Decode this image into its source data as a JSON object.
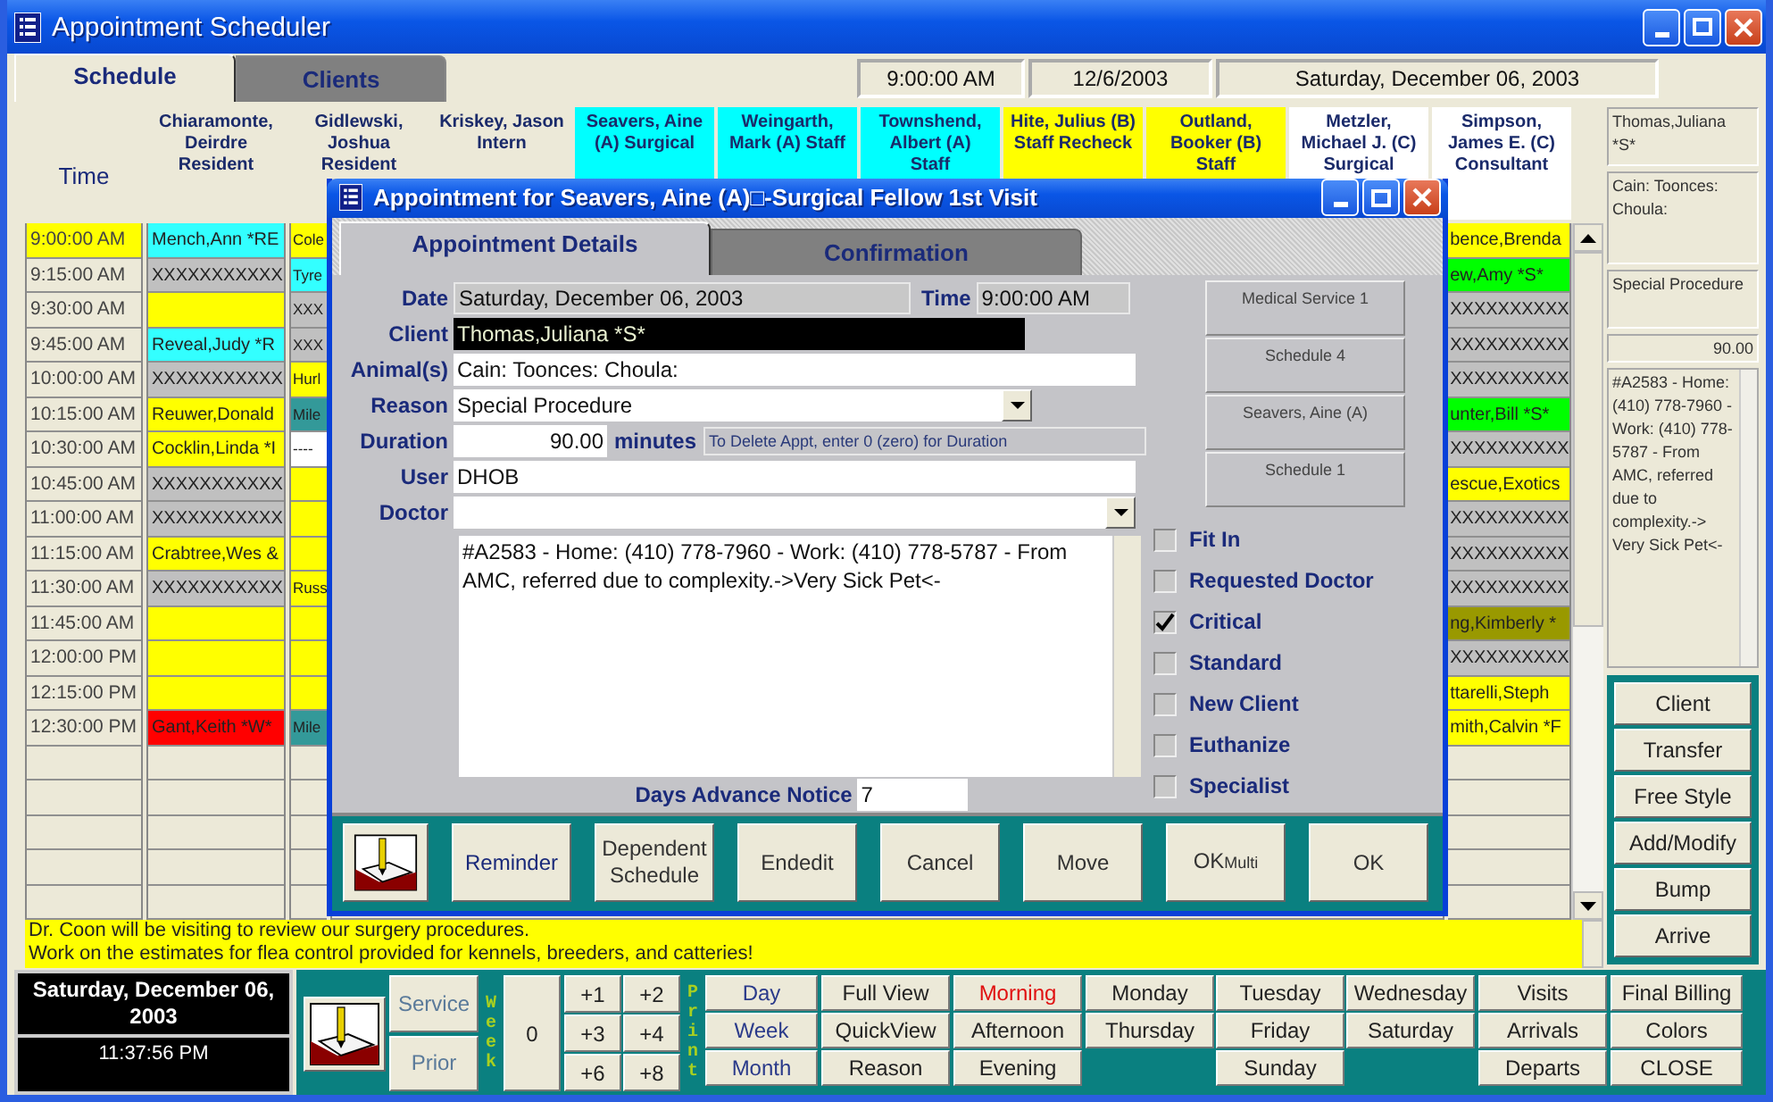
{
  "window": {
    "title": "Appointment Scheduler"
  },
  "tabs": [
    {
      "label": "Schedule",
      "selected": true
    },
    {
      "label": "Clients",
      "selected": false
    }
  ],
  "current_time": "9:00:00 AM",
  "current_date": "12/6/2003",
  "long_date": "Saturday, December 06, 2003",
  "schedule": {
    "time_heading": "Time",
    "columns": [
      {
        "name": "Chiaramonte, Deirdre Resident",
        "color": "#ece9d8"
      },
      {
        "name": "Gidlewski, Joshua Resident",
        "color": "#ece9d8"
      },
      {
        "name": "Kriskey, Jason Intern",
        "color": "#ece9d8"
      },
      {
        "name": "Seavers, Aine (A) Surgical",
        "color": "#00ffff"
      },
      {
        "name": "Weingarth, Mark (A) Staff",
        "color": "#00ffff"
      },
      {
        "name": "Townshend, Albert (A) Staff",
        "color": "#00ffff"
      },
      {
        "name": "Hite, Julius (B) Staff Recheck",
        "color": "#ffff00"
      },
      {
        "name": "Outland, Booker (B) Staff",
        "color": "#ffff00"
      },
      {
        "name": "Metzler, Michael J. (C) Surgical",
        "color": "#ffffff"
      },
      {
        "name": "Simpson, James E. (C) Consultant",
        "color": "#ffffff"
      }
    ],
    "rows": [
      {
        "time": "9:00:00 AM",
        "selected": true,
        "cells": [
          {
            "text": "Mench,Ann *RE",
            "color": "#33ffff"
          },
          {
            "text": "Cole",
            "color": "#ffff00"
          },
          {
            "text": "bence,Brenda",
            "color": "#ffff00"
          }
        ]
      },
      {
        "time": "9:15:00 AM",
        "selected": false,
        "cells": [
          {
            "text": "XXXXXXXXXXX",
            "color": "#c0c0c0"
          },
          {
            "text": "Tyre",
            "color": "#33ffff"
          },
          {
            "text": "ew,Amy *S*",
            "color": "#00ff00"
          }
        ]
      },
      {
        "time": "9:30:00 AM",
        "selected": false,
        "cells": [
          {
            "color": "#ffff00"
          },
          {
            "text": "XXX",
            "color": "#c0c0c0"
          },
          {
            "text": "XXXXXXXXXX",
            "color": "#c0c0c0"
          }
        ]
      },
      {
        "time": "9:45:00 AM",
        "selected": false,
        "cells": [
          {
            "text": "Reveal,Judy *R",
            "color": "#33ffff"
          },
          {
            "text": "XXX",
            "color": "#c0c0c0"
          },
          {
            "text": "XXXXXXXXXX",
            "color": "#c0c0c0"
          }
        ]
      },
      {
        "time": "10:00:00 AM",
        "selected": false,
        "cells": [
          {
            "text": "XXXXXXXXXXX",
            "color": "#c0c0c0"
          },
          {
            "text": "Hurl",
            "color": "#ffff00"
          },
          {
            "text": "XXXXXXXXXX",
            "color": "#c0c0c0"
          }
        ]
      },
      {
        "time": "10:15:00 AM",
        "selected": false,
        "cells": [
          {
            "text": "Reuwer,Donald",
            "color": "#ffff00"
          },
          {
            "text": "Mile",
            "color": "#339999"
          },
          {
            "text": "unter,Bill *S*",
            "color": "#00ff00"
          }
        ]
      },
      {
        "time": "10:30:00 AM",
        "selected": false,
        "cells": [
          {
            "text": "Cocklin,Linda *I",
            "color": "#ffff00"
          },
          {
            "text": "----",
            "color": "#ffffff"
          },
          {
            "text": "XXXXXXXXXX",
            "color": "#c0c0c0"
          }
        ]
      },
      {
        "time": "10:45:00 AM",
        "selected": false,
        "cells": [
          {
            "text": "XXXXXXXXXXX",
            "color": "#c0c0c0"
          },
          {
            "color": "#ffff00"
          },
          {
            "text": "escue,Exotics",
            "color": "#ffff00"
          }
        ]
      },
      {
        "time": "11:00:00 AM",
        "selected": false,
        "cells": [
          {
            "text": "XXXXXXXXXXX",
            "color": "#c0c0c0"
          },
          {
            "color": "#ffff00"
          },
          {
            "text": "XXXXXXXXXX",
            "color": "#c0c0c0"
          }
        ]
      },
      {
        "time": "11:15:00 AM",
        "selected": false,
        "cells": [
          {
            "text": "Crabtree,Wes &",
            "color": "#ffff00"
          },
          {
            "color": "#ffff00"
          },
          {
            "text": "XXXXXXXXXX",
            "color": "#c0c0c0"
          }
        ]
      },
      {
        "time": "11:30:00 AM",
        "selected": false,
        "cells": [
          {
            "text": "XXXXXXXXXXX",
            "color": "#c0c0c0"
          },
          {
            "text": "Russ",
            "color": "#ffff00"
          },
          {
            "text": "XXXXXXXXXX",
            "color": "#c0c0c0"
          }
        ]
      },
      {
        "time": "11:45:00 AM",
        "selected": false,
        "cells": [
          {
            "color": "#ffff00"
          },
          {
            "color": "#ffff00"
          },
          {
            "text": "ng,Kimberly *",
            "color": "#999900"
          }
        ]
      },
      {
        "time": "12:00:00 PM",
        "selected": false,
        "cells": [
          {
            "color": "#ffff00"
          },
          {
            "color": "#ffff00"
          },
          {
            "text": "XXXXXXXXXX",
            "color": "#c0c0c0"
          }
        ]
      },
      {
        "time": "12:15:00 PM",
        "selected": false,
        "cells": [
          {
            "color": "#ffff00"
          },
          {
            "color": "#ffff00"
          },
          {
            "text": "ttarelli,Steph",
            "color": "#ffff00"
          }
        ]
      },
      {
        "time": "12:30:00 PM",
        "selected": false,
        "cells": [
          {
            "text": "Gant,Keith *W*",
            "color": "#ff0000"
          },
          {
            "text": "Mile",
            "color": "#339999"
          },
          {
            "text": "mith,Calvin *F",
            "color": "#ffff00"
          }
        ]
      }
    ]
  },
  "messages": [
    "Dr. Coon will be visiting to review our surgery procedures.",
    "Work on the estimates for flea control provided for kennels, breeders, and catteries!"
  ],
  "side_panel": {
    "client": "Thomas,Juliana *S*",
    "animals": "Cain: Toonces: Choula:",
    "reason": "Special Procedure",
    "duration": "90.00",
    "notes": "#A2583 - Home: (410) 778-7960 - Work: (410) 778-5787 - From AMC, referred due to complexity.-> Very Sick Pet<-",
    "buttons": [
      "Client",
      "Transfer",
      "Free Style",
      "Add/Modify",
      "Bump",
      "Arrive"
    ]
  },
  "navigator": {
    "date": "Saturday, December 06, 2003",
    "clock": "11:37:56 PM",
    "service": "Service",
    "prior": "Prior",
    "week_label": "Week",
    "zero": "0",
    "offsets": [
      "+1",
      "+2",
      "+3",
      "+4",
      "+6",
      "+8"
    ],
    "print_label": "Print",
    "print_ranges": [
      "Day",
      "Week",
      "Month"
    ],
    "views": [
      "Full View",
      "QuickView",
      "Reason"
    ],
    "periods": [
      {
        "label": "Morning",
        "selected": true
      },
      {
        "label": "Afternoon",
        "selected": false
      },
      {
        "label": "Evening",
        "selected": false
      }
    ],
    "days": [
      [
        "Monday",
        "Thursday"
      ],
      [
        "Tuesday",
        "Friday",
        "Sunday"
      ],
      [
        "Wednesday",
        "Saturday"
      ]
    ],
    "lists": [
      "Visits",
      "Arrivals",
      "Departs"
    ],
    "actions": [
      "Final Billing",
      "Colors",
      "CLOSE"
    ]
  },
  "dialog": {
    "title": "Appointment for Seavers, Aine (A)□-Surgical Fellow 1st Visit",
    "tabs": [
      {
        "label": "Appointment Details",
        "selected": true
      },
      {
        "label": "Confirmation",
        "selected": false
      }
    ],
    "date": {
      "label": "Date",
      "value": "Saturday, December 06, 2003"
    },
    "time": {
      "label": "Time",
      "value": "9:00:00 AM"
    },
    "client": {
      "label": "Client",
      "value": "Thomas,Juliana *S*"
    },
    "animals": {
      "label": "Animal(s)",
      "value": "Cain: Toonces: Choula:"
    },
    "reason": {
      "label": "Reason",
      "value": "Special Procedure"
    },
    "duration": {
      "label": "Duration",
      "value": "90.00",
      "unit": "minutes",
      "hint": "To Delete Appt, enter 0 (zero) for Duration"
    },
    "user": {
      "label": "User",
      "value": "DHOB"
    },
    "doctor": {
      "label": "Doctor"
    },
    "notes": "#A2583 - Home: (410) 778-7960 - Work: (410) 778-5787 - From AMC, referred due to complexity.->Very Sick Pet<-",
    "advance_notice": {
      "label": "Days Advance Notice",
      "value": "7"
    },
    "assignments": [
      "Medical Service 1",
      "Schedule 4",
      "Seavers, Aine (A)",
      "Schedule 1"
    ],
    "flags": [
      {
        "label": "Fit In",
        "checked": false
      },
      {
        "label": "Requested Doctor",
        "checked": false
      },
      {
        "label": "Critical",
        "checked": true
      },
      {
        "label": "Standard",
        "checked": false
      },
      {
        "label": "New Client",
        "checked": false
      },
      {
        "label": "Euthanize",
        "checked": false
      },
      {
        "label": "Specialist",
        "checked": false
      }
    ],
    "buttons": [
      {
        "label": "Reminder"
      },
      {
        "label": "Dependent Schedule"
      },
      {
        "label": "Endedit"
      },
      {
        "label": "Cancel"
      },
      {
        "label": "Move"
      },
      {
        "label": "OK",
        "sub": "Multi"
      },
      {
        "label": "OK"
      }
    ]
  }
}
